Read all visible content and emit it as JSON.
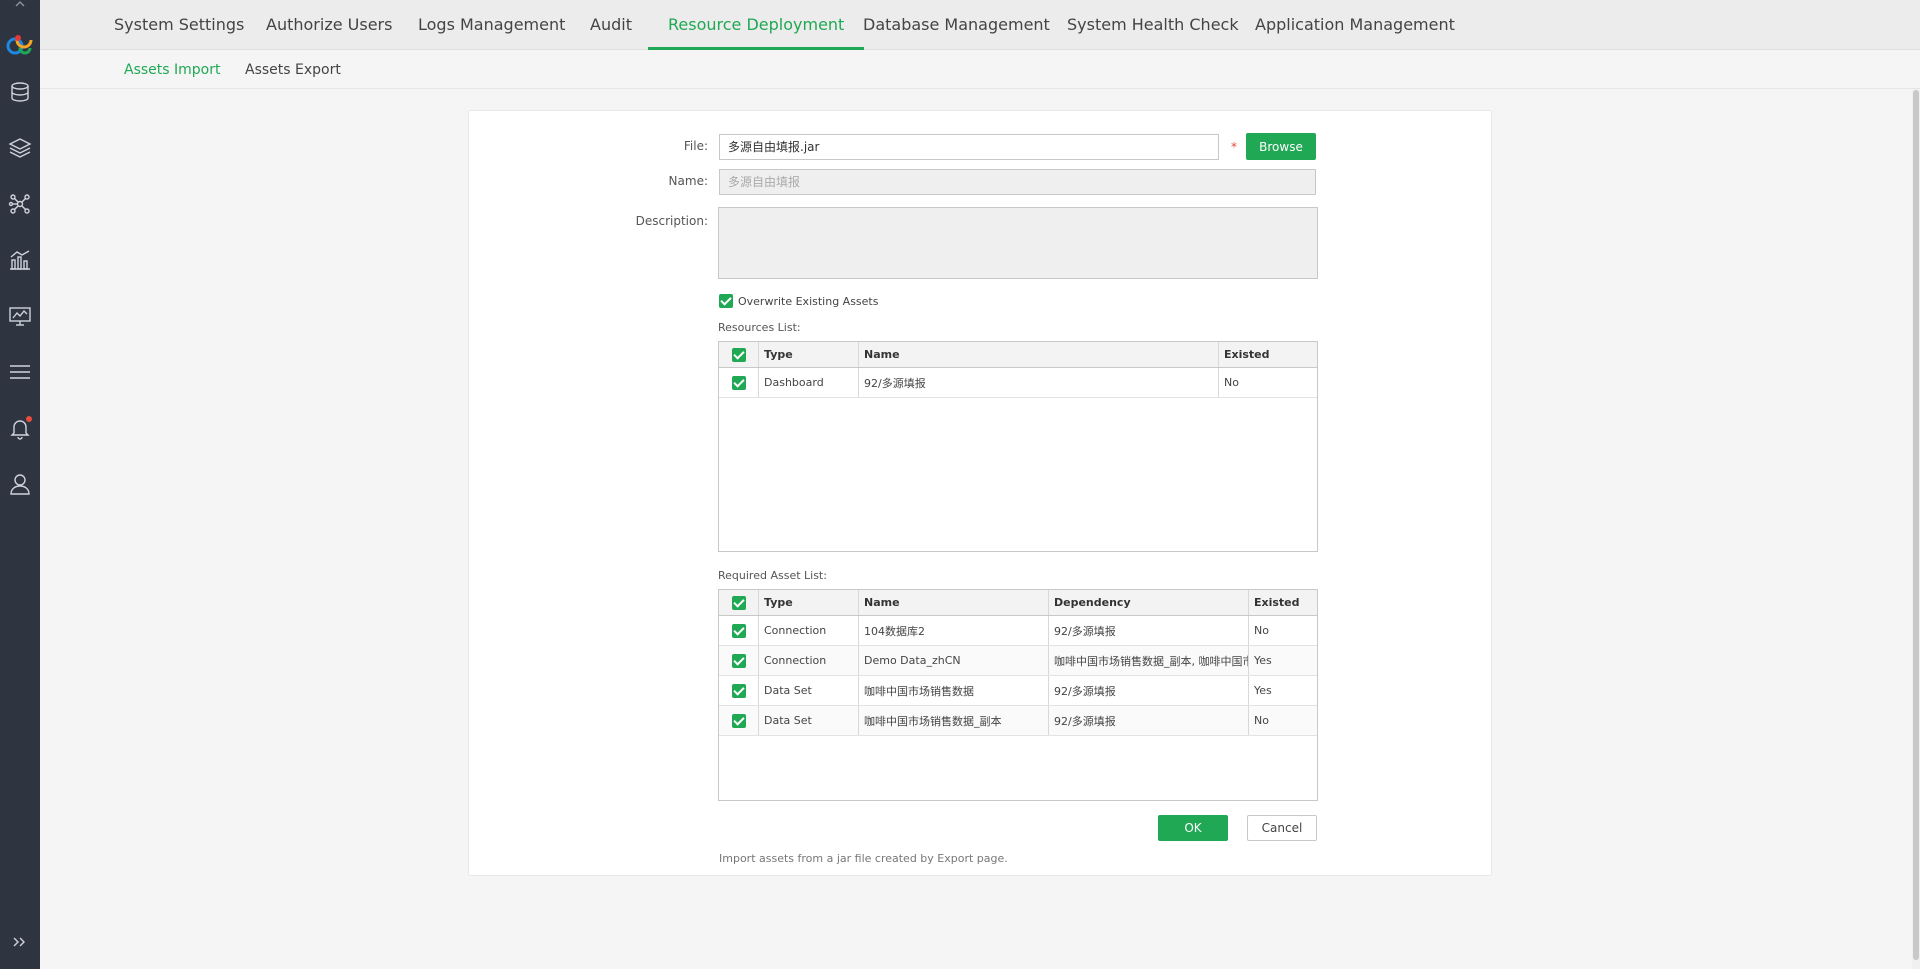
{
  "nav": {
    "tabs": [
      {
        "label": "System Settings"
      },
      {
        "label": "Authorize Users"
      },
      {
        "label": "Logs Management"
      },
      {
        "label": "Audit"
      },
      {
        "label": "Resource Deployment"
      },
      {
        "label": "Database Management"
      },
      {
        "label": "System Health Check"
      },
      {
        "label": "Application Management"
      }
    ],
    "active_tab": "Resource Deployment"
  },
  "subnav": {
    "tabs": [
      {
        "label": "Assets Import"
      },
      {
        "label": "Assets Export"
      }
    ],
    "active_tab": "Assets Import"
  },
  "sidebar": {
    "icons": [
      "logo-icon",
      "database-icon",
      "layers-icon",
      "network-icon",
      "chart-icon",
      "monitor-icon",
      "menu-icon",
      "bell-icon",
      "user-icon",
      "expand-icon"
    ]
  },
  "form": {
    "file_label": "File:",
    "file_value": "多源自由填报.jar",
    "required_mark": "*",
    "browse_label": "Browse",
    "name_label": "Name:",
    "name_placeholder": "多源自由填报",
    "description_label": "Description:",
    "overwrite_label": "Overwrite Existing Assets",
    "overwrite_checked": true
  },
  "resources": {
    "label": "Resources List:",
    "columns": [
      "Type",
      "Name",
      "Existed"
    ],
    "rows": [
      {
        "type": "Dashboard",
        "name": "92/多源填报",
        "existed": "No"
      }
    ]
  },
  "required": {
    "label": "Required Asset List:",
    "columns": [
      "Type",
      "Name",
      "Dependency",
      "Existed"
    ],
    "rows": [
      {
        "type": "Connection",
        "name": "104数据库2",
        "dependency": "92/多源填报",
        "existed": "No"
      },
      {
        "type": "Connection",
        "name": "Demo Data_zhCN",
        "dependency": "咖啡中国市场销售数据_副本, 咖啡中国市场销售数据",
        "existed": "Yes"
      },
      {
        "type": "Data Set",
        "name": "咖啡中国市场销售数据",
        "dependency": "92/多源填报",
        "existed": "Yes"
      },
      {
        "type": "Data Set",
        "name": "咖啡中国市场销售数据_副本",
        "dependency": "92/多源填报",
        "existed": "No"
      }
    ]
  },
  "actions": {
    "ok_label": "OK",
    "cancel_label": "Cancel"
  },
  "footnote": "Import assets from a jar file created by Export page.",
  "colors": {
    "accent": "#20a854",
    "sidebar": "#2e3440",
    "required": "#e74c3c"
  }
}
